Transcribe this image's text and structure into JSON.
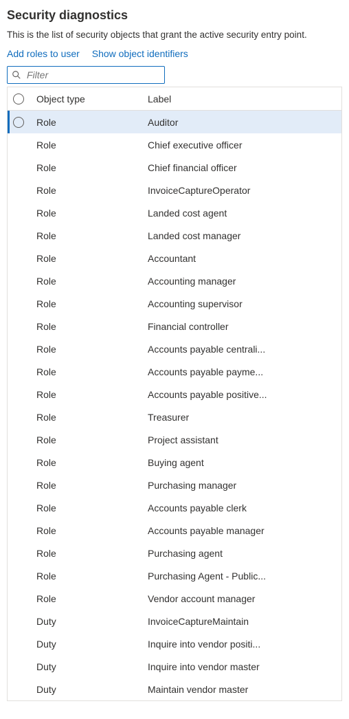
{
  "title": "Security diagnostics",
  "subtitle": "This is the list of security objects that grant the active security entry point.",
  "actions": {
    "add_roles": "Add roles to user",
    "show_ids": "Show object identifiers"
  },
  "filter": {
    "placeholder": "Filter"
  },
  "columns": {
    "object_type": "Object type",
    "label": "Label"
  },
  "rows": [
    {
      "type": "Role",
      "label": "Auditor",
      "selected": true,
      "show_radio": true
    },
    {
      "type": "Role",
      "label": "Chief executive officer",
      "selected": false,
      "show_radio": false
    },
    {
      "type": "Role",
      "label": "Chief financial officer",
      "selected": false,
      "show_radio": false
    },
    {
      "type": "Role",
      "label": "InvoiceCaptureOperator",
      "selected": false,
      "show_radio": false
    },
    {
      "type": "Role",
      "label": "Landed cost agent",
      "selected": false,
      "show_radio": false
    },
    {
      "type": "Role",
      "label": "Landed cost manager",
      "selected": false,
      "show_radio": false
    },
    {
      "type": "Role",
      "label": "Accountant",
      "selected": false,
      "show_radio": false
    },
    {
      "type": "Role",
      "label": "Accounting manager",
      "selected": false,
      "show_radio": false
    },
    {
      "type": "Role",
      "label": "Accounting supervisor",
      "selected": false,
      "show_radio": false
    },
    {
      "type": "Role",
      "label": "Financial controller",
      "selected": false,
      "show_radio": false
    },
    {
      "type": "Role",
      "label": "Accounts payable centrali...",
      "selected": false,
      "show_radio": false
    },
    {
      "type": "Role",
      "label": "Accounts payable payme...",
      "selected": false,
      "show_radio": false
    },
    {
      "type": "Role",
      "label": "Accounts payable positive...",
      "selected": false,
      "show_radio": false
    },
    {
      "type": "Role",
      "label": "Treasurer",
      "selected": false,
      "show_radio": false
    },
    {
      "type": "Role",
      "label": "Project assistant",
      "selected": false,
      "show_radio": false
    },
    {
      "type": "Role",
      "label": "Buying agent",
      "selected": false,
      "show_radio": false
    },
    {
      "type": "Role",
      "label": "Purchasing manager",
      "selected": false,
      "show_radio": false
    },
    {
      "type": "Role",
      "label": "Accounts payable clerk",
      "selected": false,
      "show_radio": false
    },
    {
      "type": "Role",
      "label": "Accounts payable manager",
      "selected": false,
      "show_radio": false
    },
    {
      "type": "Role",
      "label": "Purchasing agent",
      "selected": false,
      "show_radio": false
    },
    {
      "type": "Role",
      "label": "Purchasing Agent - Public...",
      "selected": false,
      "show_radio": false
    },
    {
      "type": "Role",
      "label": "Vendor account manager",
      "selected": false,
      "show_radio": false
    },
    {
      "type": "Duty",
      "label": "InvoiceCaptureMaintain",
      "selected": false,
      "show_radio": false
    },
    {
      "type": "Duty",
      "label": "Inquire into vendor positi...",
      "selected": false,
      "show_radio": false
    },
    {
      "type": "Duty",
      "label": "Inquire into vendor master",
      "selected": false,
      "show_radio": false
    },
    {
      "type": "Duty",
      "label": "Maintain vendor master",
      "selected": false,
      "show_radio": false
    }
  ]
}
